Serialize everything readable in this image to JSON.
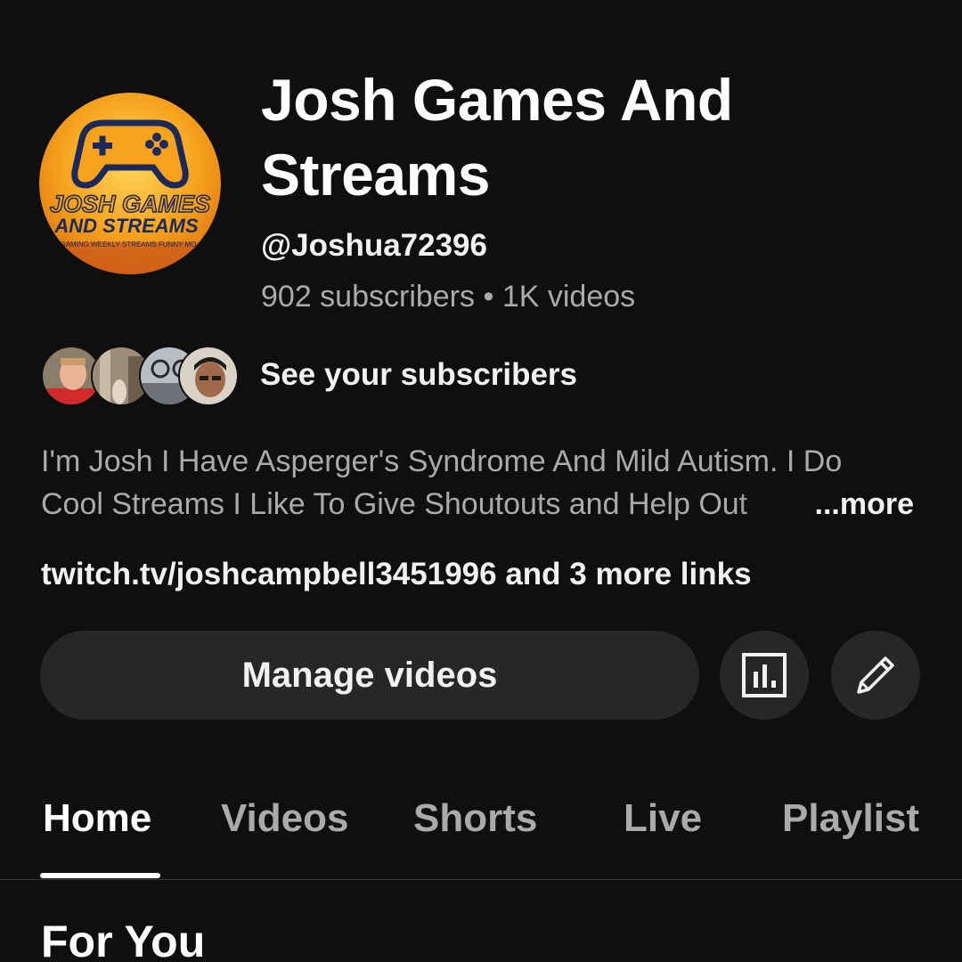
{
  "channel": {
    "title": "Josh Games And Streams",
    "handle": "@Joshua72396",
    "subscribers": "902 subscribers",
    "separator": "•",
    "videos": "1K videos",
    "logo_text_line1": "JOSH GAMES",
    "logo_text_line2": "AND STREAMS",
    "logo_text_line3": "GAMING WEEKLY STREAMS FUNNY MO"
  },
  "subscribers_row": {
    "label": "See your subscribers"
  },
  "description": {
    "line1": "I'm Josh I Have Asperger's Syndrome And Mild Autism. I Do",
    "line2": "Cool Streams I Like To Give Shoutouts and Help Out",
    "more": "...more"
  },
  "links": {
    "primary": "twitch.tv/joshcampbell3451996",
    "extra": " and 3 more links"
  },
  "actions": {
    "manage_videos": "Manage videos",
    "analytics_icon": "analytics-icon",
    "edit_icon": "pencil-icon"
  },
  "tabs": [
    {
      "label": "Home",
      "active": true
    },
    {
      "label": "Videos",
      "active": false
    },
    {
      "label": "Shorts",
      "active": false
    },
    {
      "label": "Live",
      "active": false
    },
    {
      "label": "Playlist",
      "active": false
    }
  ],
  "section": {
    "title": "For You"
  },
  "colors": {
    "background": "#0f0f0f",
    "button_bg": "#272727",
    "text_primary": "#f1f1f1",
    "text_secondary": "#aaaaaa",
    "logo_orange": "#f6a21c",
    "logo_navy": "#1b2a5b"
  }
}
